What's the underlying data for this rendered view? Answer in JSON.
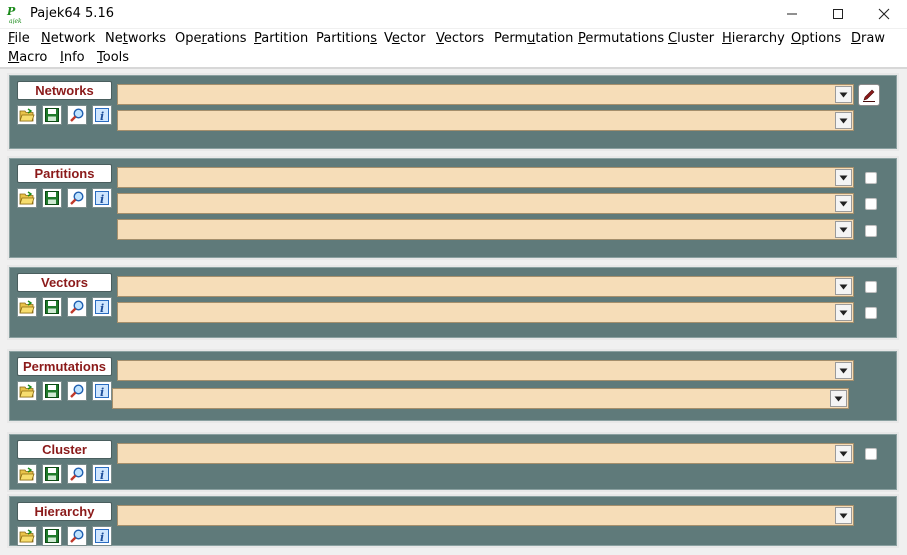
{
  "window": {
    "title": "Pajek64 5.16"
  },
  "menu": [
    {
      "label": "File",
      "mnemonic": "F"
    },
    {
      "label": "Network",
      "mnemonic": "N"
    },
    {
      "label": "Networks",
      "mnemonic": "t"
    },
    {
      "label": "Operations",
      "mnemonic": "r"
    },
    {
      "label": "Partition",
      "mnemonic": "P"
    },
    {
      "label": "Partitions",
      "mnemonic": "s"
    },
    {
      "label": "Vector",
      "mnemonic": "e"
    },
    {
      "label": "Vectors",
      "mnemonic": "V"
    },
    {
      "label": "Permutation",
      "mnemonic": "u"
    },
    {
      "label": "Permutations",
      "mnemonic": "P"
    },
    {
      "label": "Cluster",
      "mnemonic": "C"
    },
    {
      "label": "Hierarchy",
      "mnemonic": "H"
    },
    {
      "label": "Options",
      "mnemonic": "O"
    },
    {
      "label": "Draw",
      "mnemonic": "D"
    },
    {
      "label": "Macro",
      "mnemonic": "M"
    },
    {
      "label": "Info",
      "mnemonic": "I"
    },
    {
      "label": "Tools",
      "mnemonic": "T"
    }
  ],
  "panels": [
    {
      "id": "networks",
      "label": "Networks",
      "dropdowns": [
        "",
        ""
      ],
      "has_edit_button": true,
      "checkboxes": 0
    },
    {
      "id": "partitions",
      "label": "Partitions",
      "dropdowns": [
        "",
        "",
        ""
      ],
      "has_edit_button": false,
      "checkboxes": 3
    },
    {
      "id": "vectors",
      "label": "Vectors",
      "dropdowns": [
        "",
        ""
      ],
      "has_edit_button": false,
      "checkboxes": 2
    },
    {
      "id": "permutations",
      "label": "Permutations",
      "dropdowns": [
        "",
        ""
      ],
      "has_edit_button": false,
      "checkboxes": 0
    },
    {
      "id": "cluster",
      "label": "Cluster",
      "dropdowns": [
        ""
      ],
      "has_edit_button": false,
      "checkboxes": 1
    },
    {
      "id": "hierarchy",
      "label": "Hierarchy",
      "dropdowns": [
        ""
      ],
      "has_edit_button": false,
      "checkboxes": 0
    }
  ],
  "panel_icons": [
    "open-folder-icon",
    "save-disk-icon",
    "magnifier-icon",
    "info-icon"
  ],
  "colors": {
    "panel_bg": "#5f7a7a",
    "combo_bg": "#f6ddb8",
    "label_text": "#8b1a1a"
  }
}
